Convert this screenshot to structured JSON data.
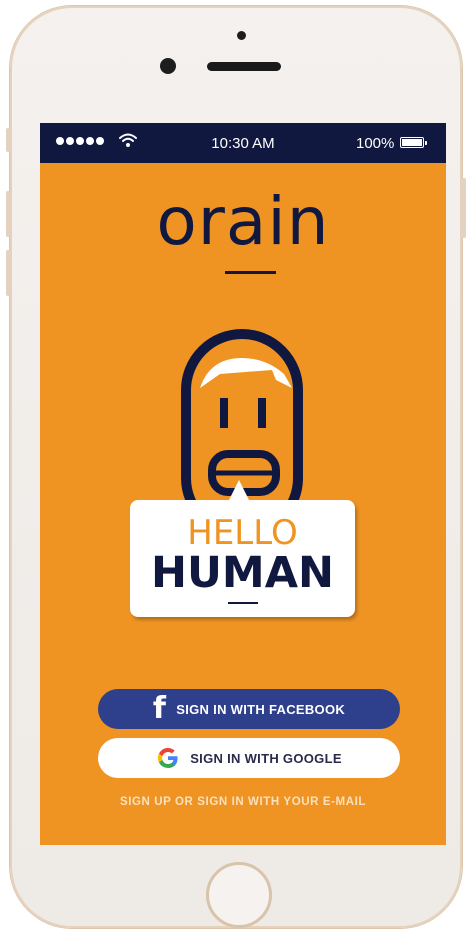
{
  "status_bar": {
    "time": "10:30 AM",
    "battery": "100%"
  },
  "app": {
    "logo_text": "orain"
  },
  "greeting": {
    "line1": "HELLO",
    "line2": "HUMAN"
  },
  "auth": {
    "facebook_label": "SIGN IN WITH FACEBOOK",
    "google_label": "SIGN IN WITH GOOGLE",
    "email_link": "SIGN UP OR SIGN IN WITH YOUR E-MAIL"
  },
  "colors": {
    "background": "#ef9423",
    "navy": "#101840",
    "facebook_blue": "#2e3f8c"
  },
  "icons": [
    "wifi-icon",
    "battery-icon",
    "facebook-icon",
    "google-icon"
  ]
}
